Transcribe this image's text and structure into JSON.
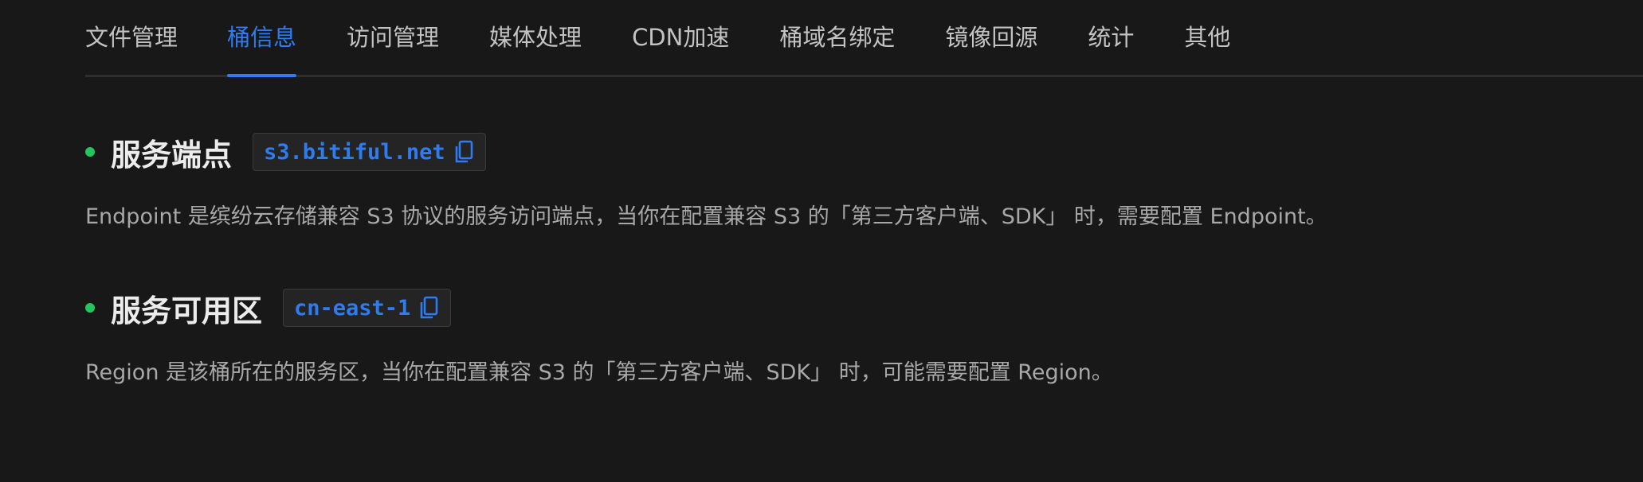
{
  "tabs": [
    {
      "label": "文件管理",
      "active": false
    },
    {
      "label": "桶信息",
      "active": true
    },
    {
      "label": "访问管理",
      "active": false
    },
    {
      "label": "媒体处理",
      "active": false
    },
    {
      "label": "CDN加速",
      "active": false
    },
    {
      "label": "桶域名绑定",
      "active": false
    },
    {
      "label": "镜像回源",
      "active": false
    },
    {
      "label": "统计",
      "active": false
    },
    {
      "label": "其他",
      "active": false
    }
  ],
  "endpoint": {
    "title": "服务端点",
    "value": "s3.bitiful.net",
    "description": "Endpoint 是缤纷云存储兼容 S3 协议的服务访问端点，当你在配置兼容 S3 的「第三方客户端、SDK」 时，需要配置 Endpoint。"
  },
  "region": {
    "title": "服务可用区",
    "value": "cn-east-1",
    "description": "Region 是该桶所在的服务区，当你在配置兼容 S3 的「第三方客户端、SDK」 时，可能需要配置 Region。"
  },
  "colors": {
    "accent": "#2f7bf0",
    "status_dot": "#22c55e",
    "background": "#181818"
  },
  "icons": {
    "copy": "copy-icon",
    "bullet": "status-dot"
  }
}
